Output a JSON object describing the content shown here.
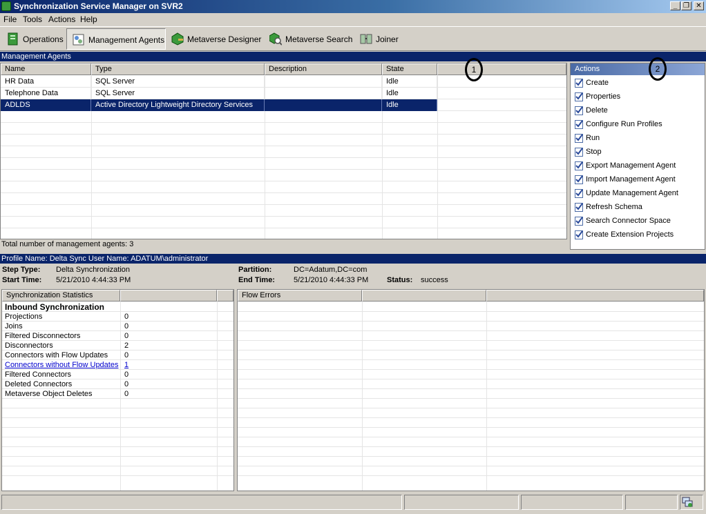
{
  "window": {
    "title": "Synchronization Service Manager on SVR2",
    "controls": [
      "_",
      "❐",
      "✕"
    ]
  },
  "menu": [
    "File",
    "Tools",
    "Actions",
    "Help"
  ],
  "toolbar": [
    {
      "label": "Operations",
      "icon": "operations-icon",
      "active": false
    },
    {
      "label": "Management Agents",
      "icon": "management-agents-icon",
      "active": true
    },
    {
      "label": "Metaverse Designer",
      "icon": "metaverse-designer-icon",
      "active": false
    },
    {
      "label": "Metaverse Search",
      "icon": "metaverse-search-icon",
      "active": false
    },
    {
      "label": "Joiner",
      "icon": "joiner-icon",
      "active": false
    }
  ],
  "management_agents": {
    "header": "Management Agents",
    "columns": [
      "Name",
      "Type",
      "Description",
      "State"
    ],
    "rows": [
      {
        "name": "HR Data",
        "type": "SQL Server",
        "description": "",
        "state": "Idle",
        "selected": false
      },
      {
        "name": "Telephone Data",
        "type": "SQL Server",
        "description": "",
        "state": "Idle",
        "selected": false
      },
      {
        "name": "ADLDS",
        "type": "Active Directory Lightweight Directory Services",
        "description": "",
        "state": "Idle",
        "selected": true
      }
    ],
    "total_text": "Total number of management agents: 3"
  },
  "annotations": {
    "one": "1",
    "two": "2"
  },
  "actions": {
    "header": "Actions",
    "items": [
      "Create",
      "Properties",
      "Delete",
      "Configure Run Profiles",
      "Run",
      "Stop",
      "Export Management Agent",
      "Import Management Agent",
      "Update Management Agent",
      "Refresh Schema",
      "Search Connector Space",
      "Create Extension Projects"
    ]
  },
  "profile": {
    "header": "Profile Name: Delta Sync  User Name: ADATUM\\administrator",
    "step_type_label": "Step Type:",
    "step_type": "Delta Synchronization",
    "start_time_label": "Start Time:",
    "start_time": "5/21/2010 4:44:33 PM",
    "partition_label": "Partition:",
    "partition": "DC=Adatum,DC=com",
    "end_time_label": "End Time:",
    "end_time": "5/21/2010 4:44:33 PM",
    "status_label": "Status:",
    "status": "success"
  },
  "sync_stats": {
    "header": "Synchronization Statistics",
    "section": "Inbound Synchronization",
    "rows": [
      {
        "label": "Projections",
        "value": "0",
        "link": false
      },
      {
        "label": "Joins",
        "value": "0",
        "link": false
      },
      {
        "label": "Filtered Disconnectors",
        "value": "0",
        "link": false
      },
      {
        "label": "Disconnectors",
        "value": "2",
        "link": false
      },
      {
        "label": "Connectors with Flow Updates",
        "value": "0",
        "link": false
      },
      {
        "label": "Connectors without Flow Updates",
        "value": "1",
        "link": true
      },
      {
        "label": "Filtered Connectors",
        "value": "0",
        "link": false
      },
      {
        "label": "Deleted Connectors",
        "value": "0",
        "link": false
      },
      {
        "label": "Metaverse Object Deletes",
        "value": "0",
        "link": false
      }
    ]
  },
  "flow_errors": {
    "header": "Flow Errors"
  },
  "colors": {
    "selection": "#0a246a",
    "header_bar": "#0a246a",
    "link": "#0000cc"
  }
}
